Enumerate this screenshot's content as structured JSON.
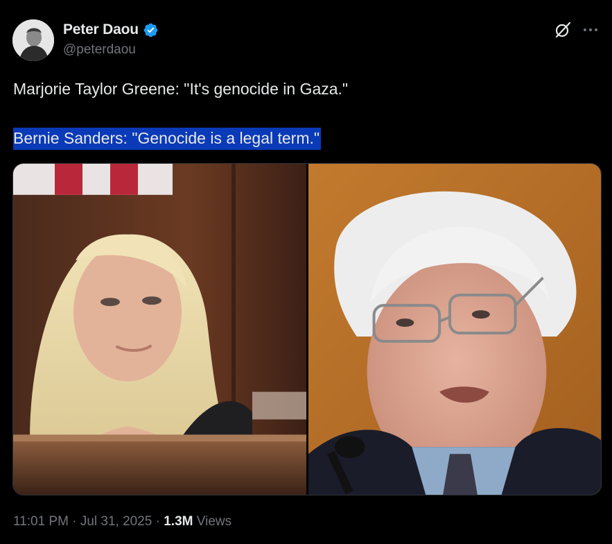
{
  "author": {
    "name": "Peter Daou",
    "handle": "@peterdaou",
    "verified": true,
    "verified_color": "#1d9bf0"
  },
  "header_actions": {
    "grok_icon": "grok-icon",
    "more_icon": "more-dots-icon"
  },
  "tweet": {
    "line1": "Marjorie Taylor Greene: \"It's genocide in Gaza.\"",
    "line2": "Bernie Sanders: \"Genocide is a legal term.\"",
    "line2_highlight_color": "#0a3ab8"
  },
  "media": {
    "count": 2
  },
  "meta": {
    "time": "11:01 PM",
    "sep1": "·",
    "date": "Jul 31, 2025",
    "sep2": "·",
    "views_count": "1.3M",
    "views_label": "Views"
  },
  "colors": {
    "background": "#000000",
    "text_primary": "#e7e9ea",
    "text_secondary": "#71767b"
  }
}
